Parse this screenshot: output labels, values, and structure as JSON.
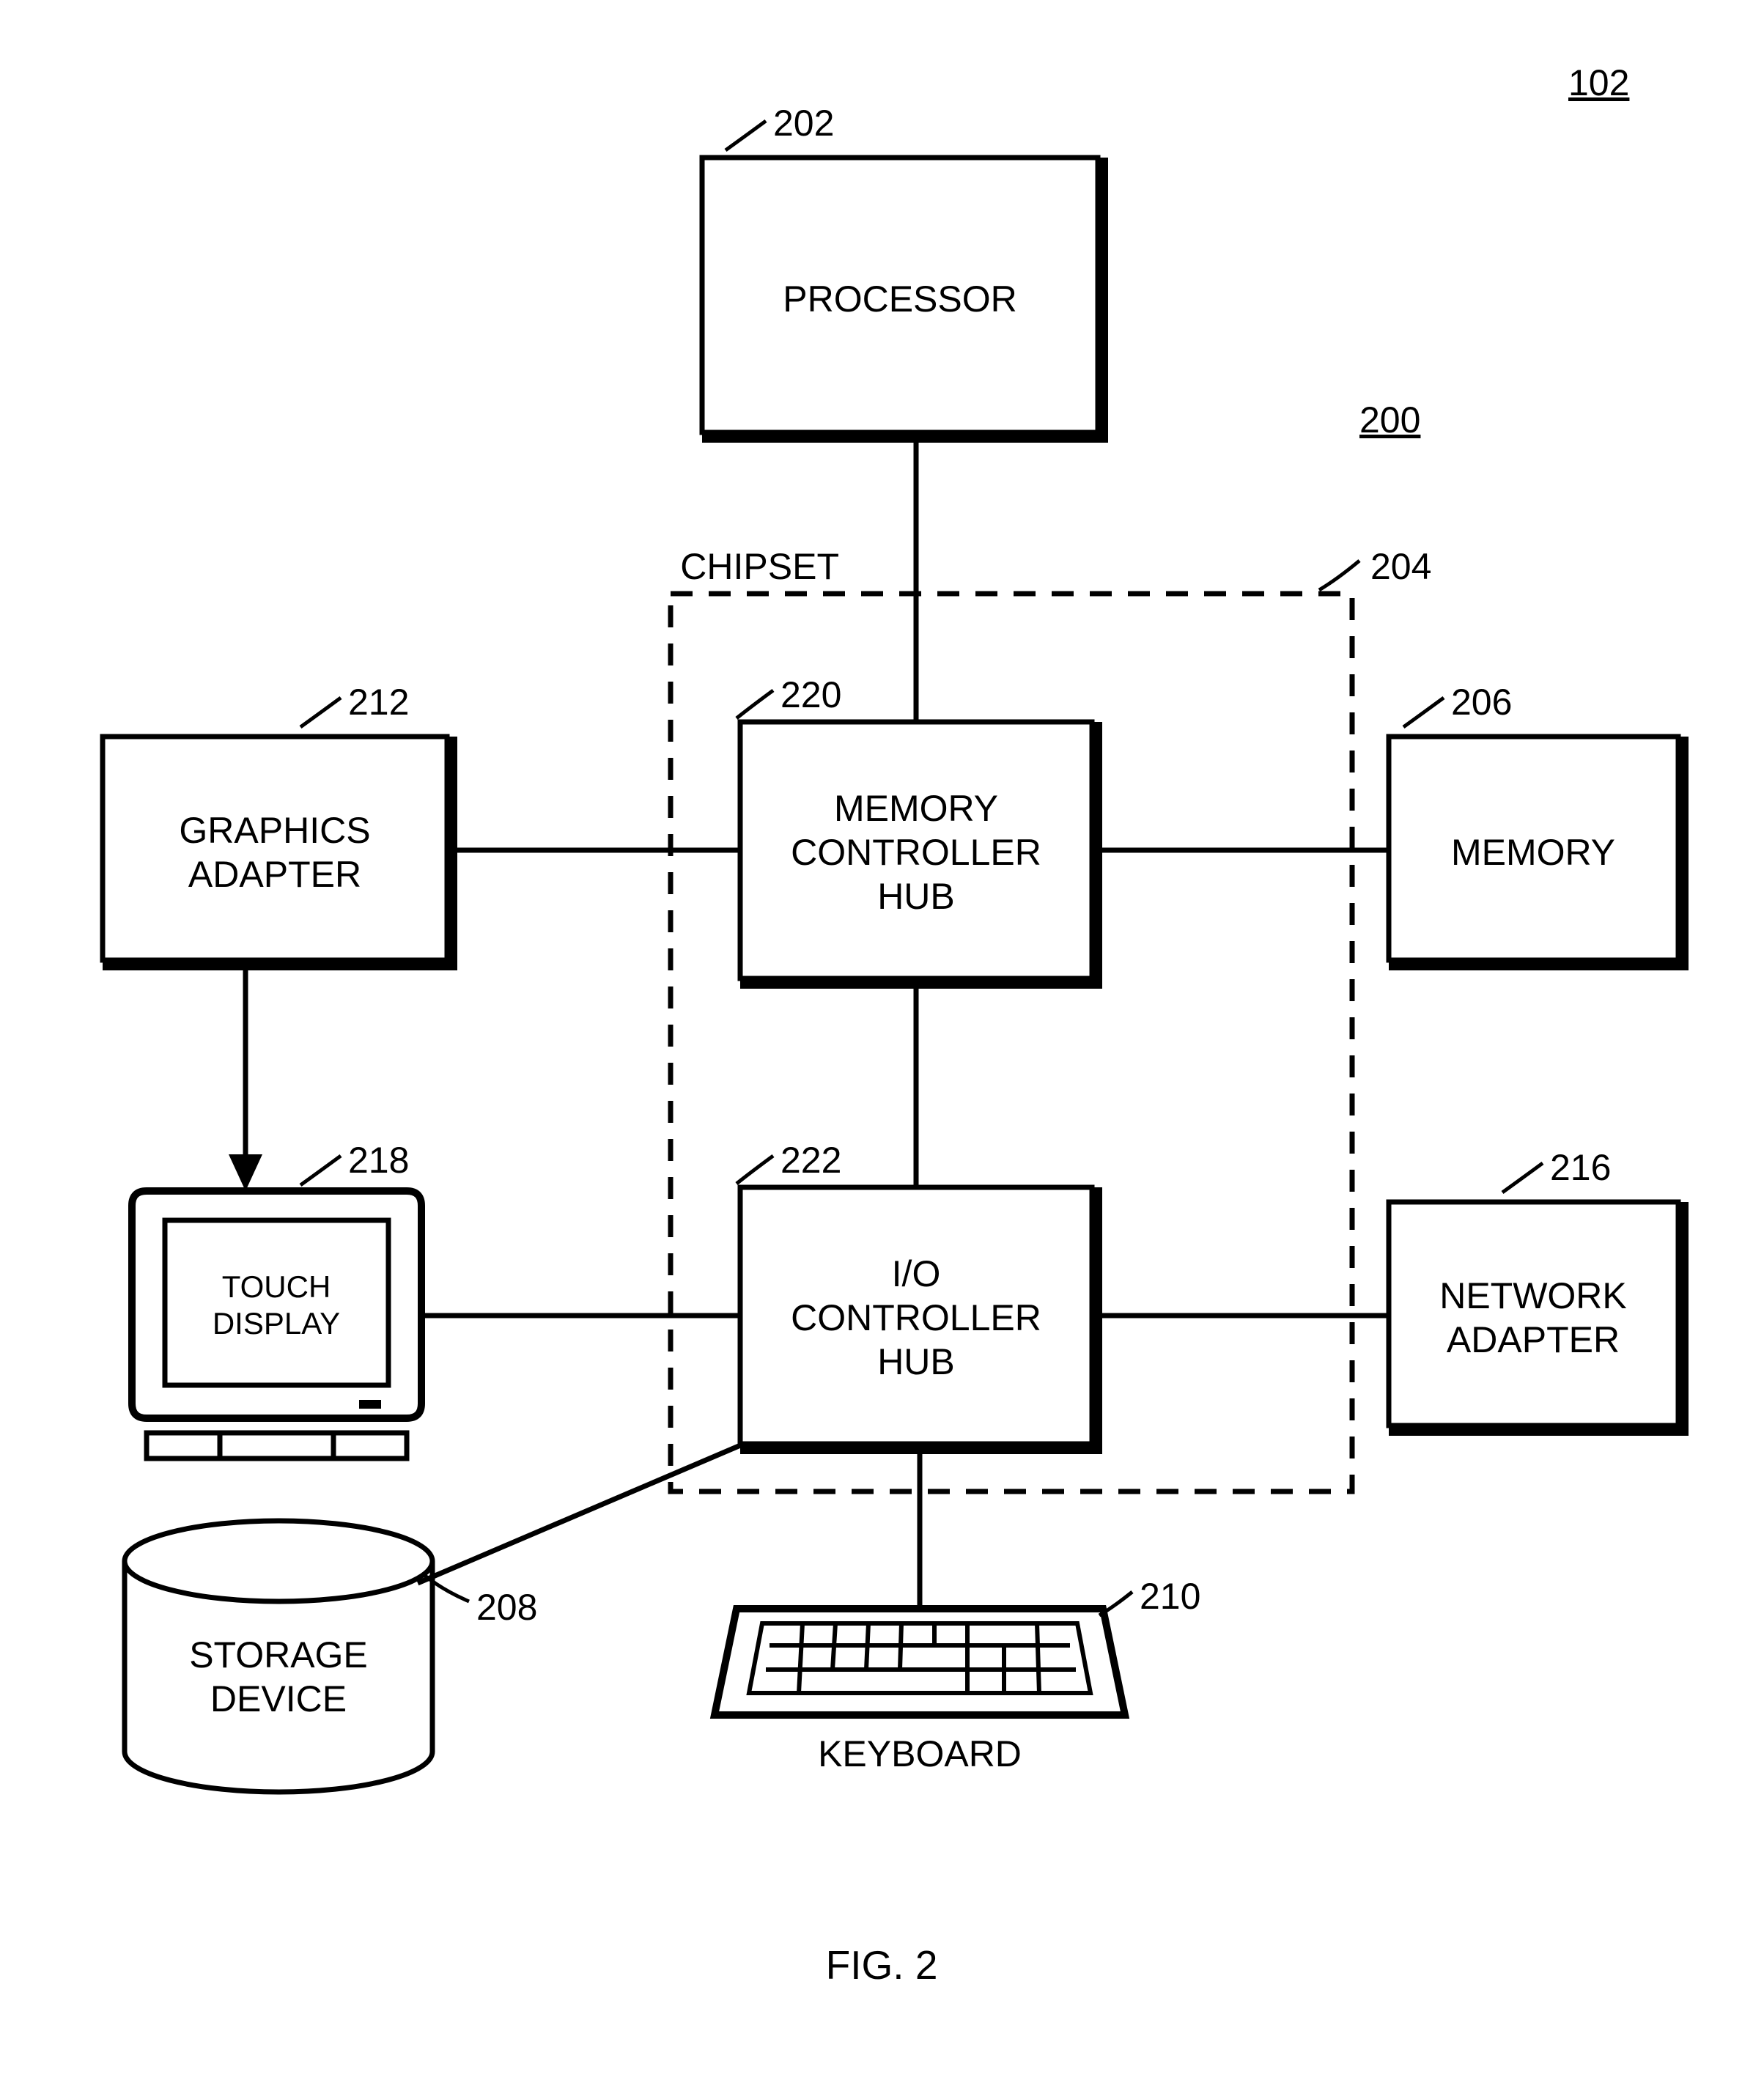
{
  "figure": {
    "caption": "FIG. 2",
    "overall_ref": "102",
    "system_ref": "200"
  },
  "blocks": {
    "processor": {
      "ref": "202",
      "label1": "PROCESSOR"
    },
    "chipset": {
      "ref": "204",
      "label1": "CHIPSET"
    },
    "memory": {
      "ref": "206",
      "label1": "MEMORY"
    },
    "storage": {
      "ref": "208",
      "label1": "STORAGE",
      "label2": "DEVICE"
    },
    "keyboard": {
      "ref": "210",
      "label1": "KEYBOARD"
    },
    "graphics_adapter": {
      "ref": "212",
      "label1": "GRAPHICS",
      "label2": "ADAPTER"
    },
    "network_adapter": {
      "ref": "216",
      "label1": "NETWORK",
      "label2": "ADAPTER"
    },
    "touch_display": {
      "ref": "218",
      "label1": "TOUCH",
      "label2": "DISPLAY"
    },
    "mem_ctrl_hub": {
      "ref": "220",
      "label1": "MEMORY",
      "label2": "CONTROLLER",
      "label3": "HUB"
    },
    "io_ctrl_hub": {
      "ref": "222",
      "label1": "I/O",
      "label2": "CONTROLLER",
      "label3": "HUB"
    }
  }
}
